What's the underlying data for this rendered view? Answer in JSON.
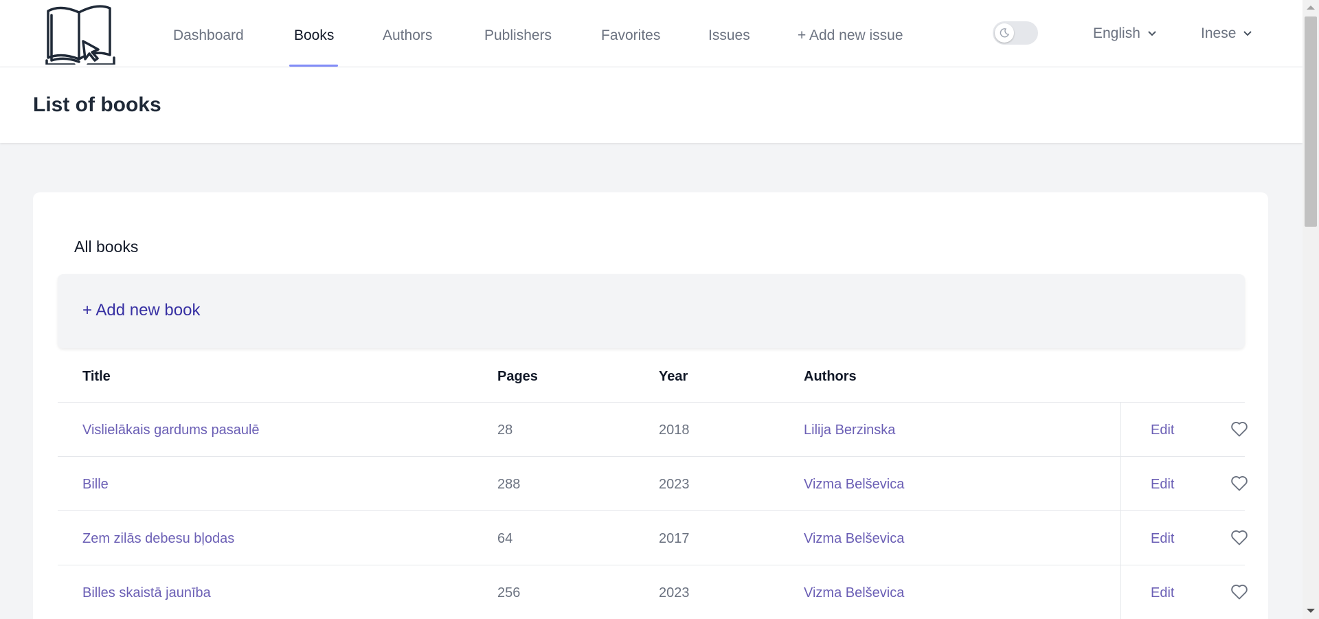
{
  "nav": {
    "links": [
      {
        "label": "Dashboard",
        "active": false
      },
      {
        "label": "Books",
        "active": true
      },
      {
        "label": "Authors",
        "active": false
      },
      {
        "label": "Publishers",
        "active": false
      },
      {
        "label": "Favorites",
        "active": false
      },
      {
        "label": "Issues",
        "active": false
      },
      {
        "label": "+ Add new issue",
        "active": false
      }
    ],
    "theme_toggle_icon": "moon-icon",
    "language": "English",
    "user": "Inese"
  },
  "header": {
    "title": "List of books"
  },
  "card": {
    "title": "All books",
    "add_label": "+ Add new book",
    "columns": [
      "Title",
      "Pages",
      "Year",
      "Authors"
    ],
    "edit_label": "Edit",
    "rows": [
      {
        "title": "Vislielākais gardums pasaulē",
        "pages": "28",
        "year": "2018",
        "authors": "Lilija Berzinska"
      },
      {
        "title": "Bille",
        "pages": "288",
        "year": "2023",
        "authors": "Vizma Belševica"
      },
      {
        "title": "Zem zilās debesu bļodas",
        "pages": "64",
        "year": "2017",
        "authors": "Vizma Belševica"
      },
      {
        "title": "Billes skaistā jaunība",
        "pages": "256",
        "year": "2023",
        "authors": "Vizma Belševica"
      }
    ]
  },
  "colors": {
    "accent": "#818cf8",
    "link": "#6b5fb5",
    "add_link": "#3730a3"
  }
}
